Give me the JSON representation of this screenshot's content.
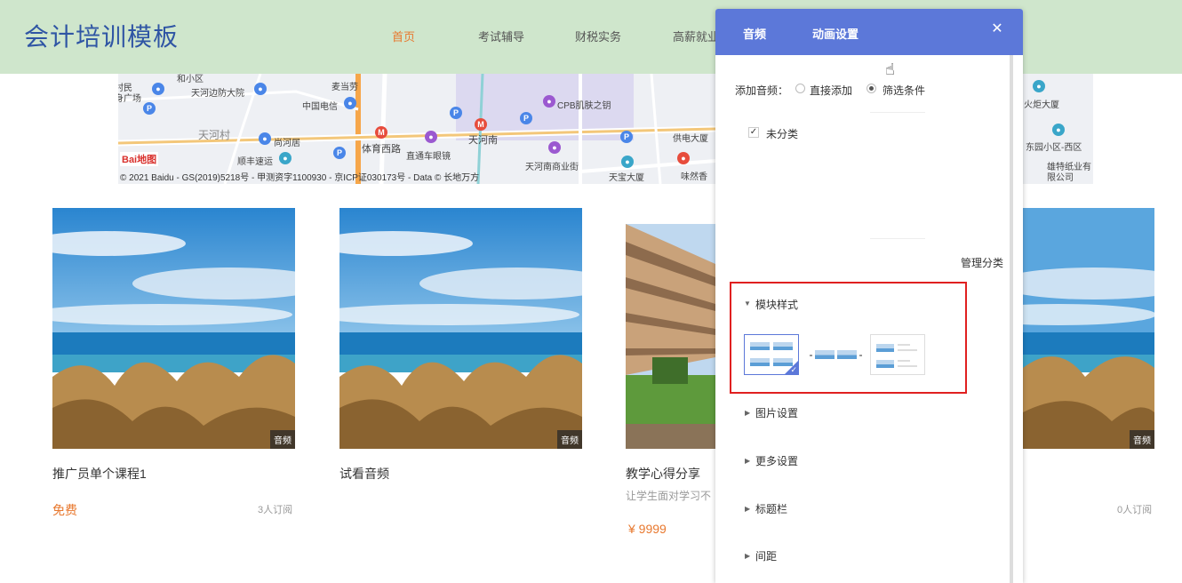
{
  "header": {
    "brand": "会计培训模板",
    "nav": [
      "首页",
      "考试辅导",
      "财税实务",
      "高薪就业"
    ]
  },
  "map": {
    "labels": [
      "和小区",
      "村民",
      "身广场",
      "天河边防大院",
      "麦当劳",
      "中国电信",
      "CPB肌肤之钥",
      "天河村",
      "尚河居",
      "体育西路",
      "天河南",
      "供电大厦",
      "顺丰速运",
      "直通车眼镜",
      "天河南商业街",
      "天宝大厦",
      "味然香",
      "东园小区-西区",
      "雄特纸业有限公司",
      "火炬大厦"
    ],
    "baidu_logo": "Bai地图",
    "copyright": "© 2021 Baidu - GS(2019)5218号 - 甲测资字1100930 - 京ICP证030173号 - Data © 长地万方"
  },
  "cards": [
    {
      "title": "推广员单个课程1",
      "price": "免费",
      "subs": "3人订阅",
      "badge": "音频"
    },
    {
      "title": "试看音频",
      "badge": "音频"
    },
    {
      "title": "教学心得分享",
      "subtitle": "让学生面对学习不",
      "price": "¥ 9999"
    },
    {
      "subs": "0人订阅",
      "badge": "音频"
    }
  ],
  "panel": {
    "tabs": [
      "音频",
      "动画设置"
    ],
    "close_icon": "close-icon",
    "add_audio_label": "添加音频：",
    "radio_options": [
      "直接添加",
      "筛选条件"
    ],
    "radio_selected": "筛选条件",
    "uncategorized": "未分类",
    "manage_category": "管理分类",
    "sections": {
      "module_style": "模块样式",
      "image_settings": "图片设置",
      "more_settings": "更多设置",
      "title_bar": "标题栏",
      "spacing": "间距"
    }
  },
  "colors": {
    "header_bg": "#cfe6cc",
    "brand": "#2f55a4",
    "accent": "#e8782e",
    "panel_head": "#5c78d9",
    "highlight_box": "#e02020"
  }
}
